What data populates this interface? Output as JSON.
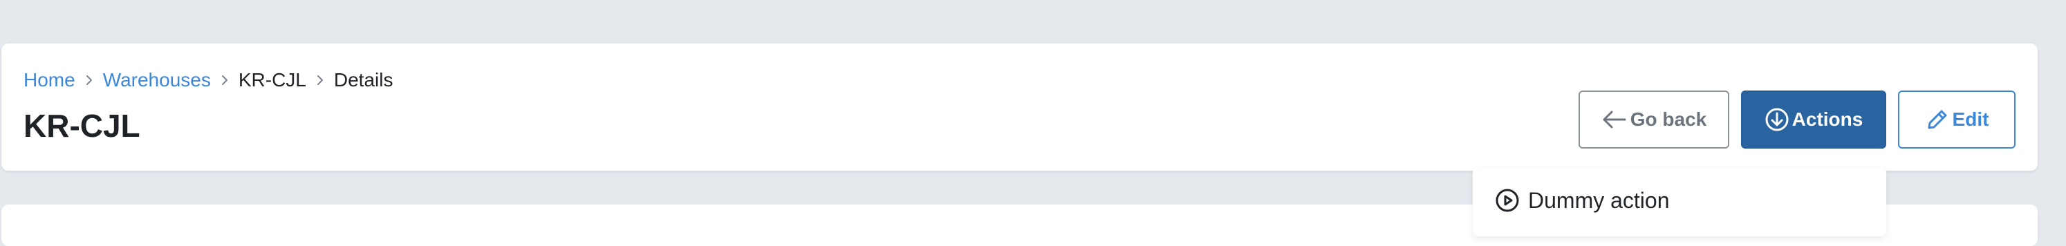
{
  "breadcrumb": {
    "items": [
      {
        "label": "Home",
        "link": true
      },
      {
        "label": "Warehouses",
        "link": true
      },
      {
        "label": "KR-CJL",
        "link": false
      },
      {
        "label": "Details",
        "link": false
      }
    ]
  },
  "page": {
    "title": "KR-CJL"
  },
  "toolbar": {
    "go_back_label": "Go back",
    "actions_label": "Actions",
    "edit_label": "Edit"
  },
  "actions_menu": {
    "items": [
      {
        "label": "Dummy action",
        "icon": "play-circle-icon"
      }
    ]
  },
  "colors": {
    "background": "#e5e9ee",
    "link": "#3b87d9",
    "primary": "#2a64a0",
    "text": "#1f2328",
    "muted": "#6b737d"
  }
}
